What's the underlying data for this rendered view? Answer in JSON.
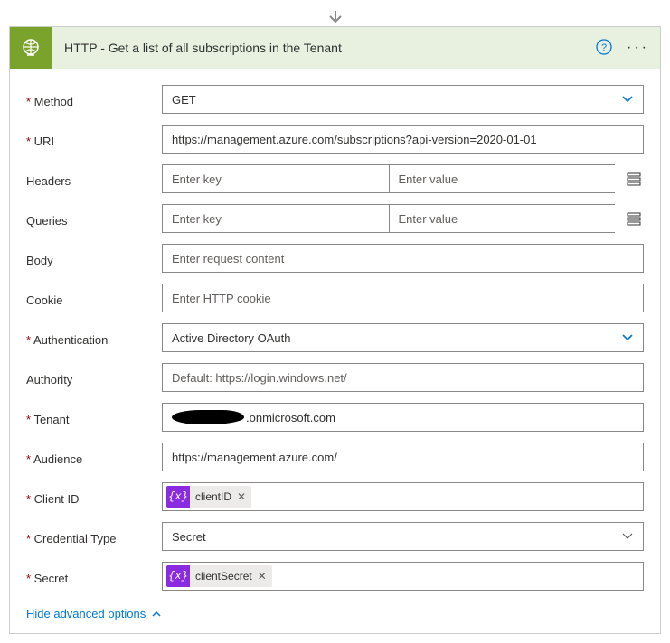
{
  "header": {
    "title": "HTTP - Get a list of all subscriptions in the Tenant"
  },
  "fields": {
    "method": {
      "label": "Method",
      "value": "GET"
    },
    "uri": {
      "label": "URI",
      "value": "https://management.azure.com/subscriptions?api-version=2020-01-01"
    },
    "headers": {
      "label": "Headers",
      "key_ph": "Enter key",
      "val_ph": "Enter value"
    },
    "queries": {
      "label": "Queries",
      "key_ph": "Enter key",
      "val_ph": "Enter value"
    },
    "body": {
      "label": "Body",
      "ph": "Enter request content"
    },
    "cookie": {
      "label": "Cookie",
      "ph": "Enter HTTP cookie"
    },
    "auth": {
      "label": "Authentication",
      "value": "Active Directory OAuth"
    },
    "authority": {
      "label": "Authority",
      "ph": "Default: https://login.windows.net/"
    },
    "tenant": {
      "label": "Tenant",
      "suffix": ".onmicrosoft.com"
    },
    "audience": {
      "label": "Audience",
      "value": "https://management.azure.com/"
    },
    "client_id": {
      "label": "Client ID",
      "token": "clientID"
    },
    "cred_type": {
      "label": "Credential Type",
      "value": "Secret"
    },
    "secret": {
      "label": "Secret",
      "token": "clientSecret"
    }
  },
  "footer": {
    "hide_advanced": "Hide advanced options"
  }
}
